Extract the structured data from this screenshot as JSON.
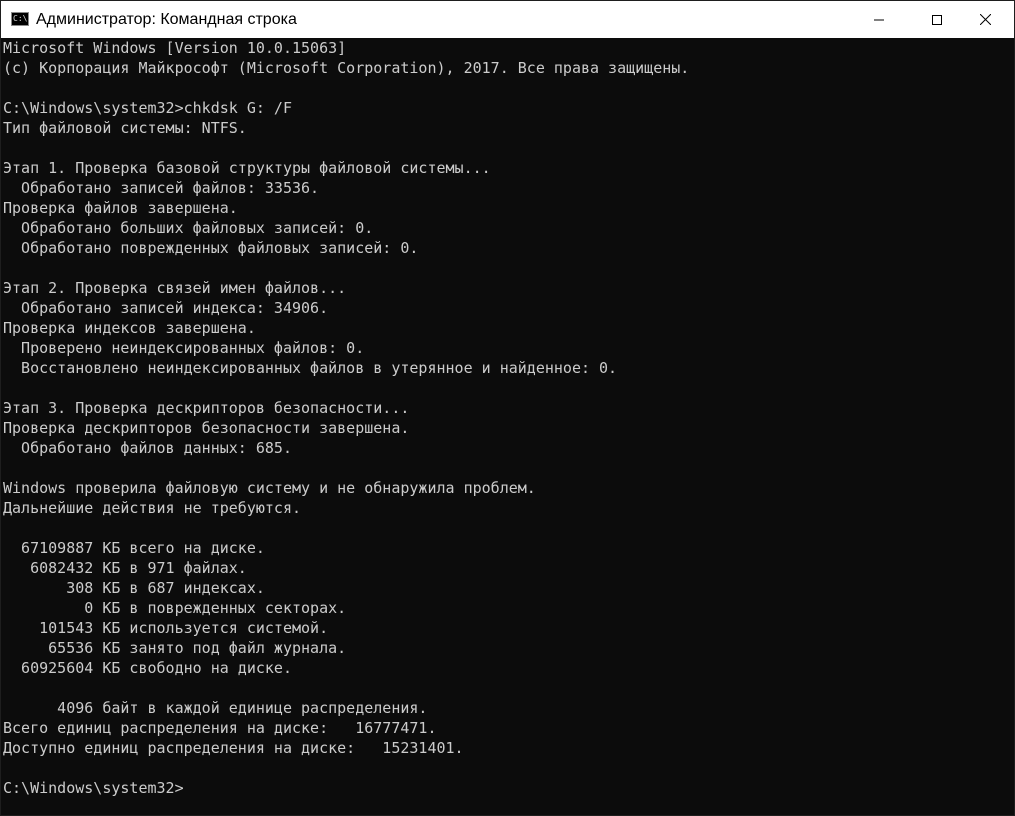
{
  "window": {
    "title": "Администратор: Командная строка",
    "icon_label": "C:\\.",
    "controls": {
      "minimize": "minimize-icon",
      "maximize": "maximize-icon",
      "close": "close-icon"
    }
  },
  "colors": {
    "console_background": "#0c0c0c",
    "console_text": "#cccccc",
    "titlebar_background": "#ffffff"
  },
  "console": {
    "lines": [
      "Microsoft Windows [Version 10.0.15063]",
      "(c) Корпорация Майкрософт (Microsoft Corporation), 2017. Все права защищены.",
      "",
      "C:\\Windows\\system32>chkdsk G: /F",
      "Тип файловой системы: NTFS.",
      "",
      "Этап 1. Проверка базовой структуры файловой системы...",
      "  Обработано записей файлов: 33536.",
      "Проверка файлов завершена.",
      "  Обработано больших файловых записей: 0.",
      "  Обработано поврежденных файловых записей: 0.",
      "",
      "Этап 2. Проверка связей имен файлов...",
      "  Обработано записей индекса: 34906.",
      "Проверка индексов завершена.",
      "  Проверено неиндексированных файлов: 0.",
      "  Восстановлено неиндексированных файлов в утерянное и найденное: 0.",
      "",
      "Этап 3. Проверка дескрипторов безопасности...",
      "Проверка дескрипторов безопасности завершена.",
      "  Обработано файлов данных: 685.",
      "",
      "Windows проверила файловую систему и не обнаружила проблем.",
      "Дальнейшие действия не требуются.",
      "",
      "  67109887 КБ всего на диске.",
      "   6082432 КБ в 971 файлах.",
      "       308 КБ в 687 индексах.",
      "         0 КБ в поврежденных секторах.",
      "    101543 КБ используется системой.",
      "     65536 КБ занято под файл журнала.",
      "  60925604 КБ свободно на диске.",
      "",
      "      4096 байт в каждой единице распределения.",
      "Всего единиц распределения на диске:   16777471.",
      "Доступно единиц распределения на диске:   15231401.",
      "",
      "C:\\Windows\\system32>"
    ]
  }
}
